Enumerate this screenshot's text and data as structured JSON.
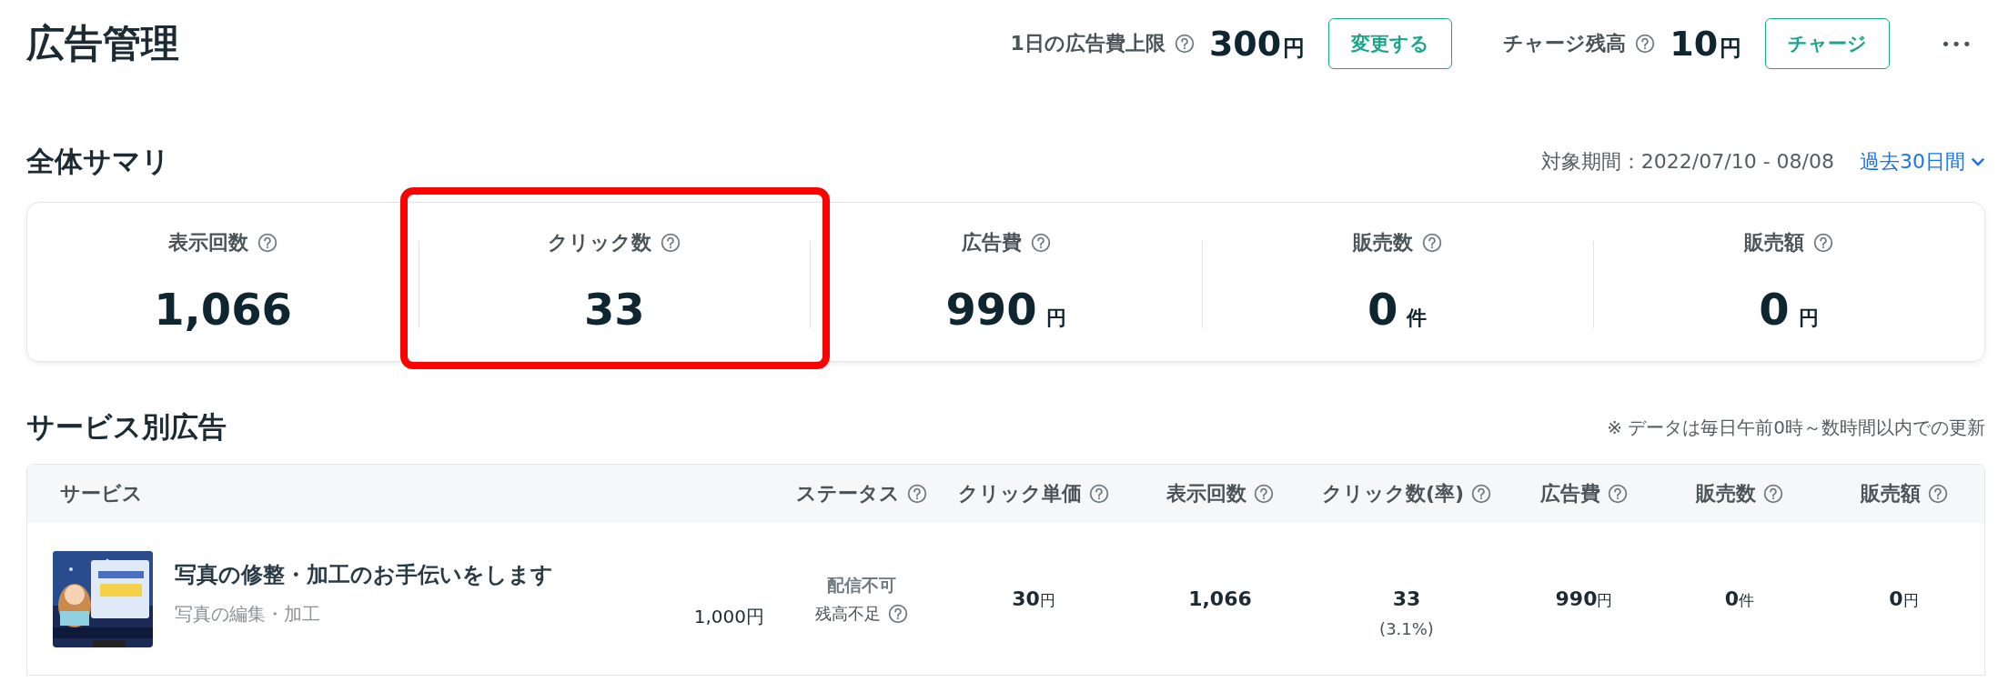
{
  "page_title": "広告管理",
  "header": {
    "daily_limit": {
      "label": "1日の広告費上限",
      "value": "300",
      "unit": "円",
      "button": "変更する"
    },
    "balance": {
      "label": "チャージ残高",
      "value": "10",
      "unit": "円",
      "button": "チャージ"
    },
    "more": "•••"
  },
  "summary": {
    "title": "全体サマリ",
    "period": "対象期間：2022/07/10 - 08/08",
    "range": "過去30日間",
    "metrics": [
      {
        "label": "表示回数",
        "value": "1,066",
        "highlighted": false
      },
      {
        "label": "クリック数",
        "value": "33",
        "highlighted": true
      },
      {
        "label": "広告費",
        "value": "990",
        "unit": "円",
        "highlighted": false
      },
      {
        "label": "販売数",
        "value": "0",
        "unit": "件",
        "highlighted": false
      },
      {
        "label": "販売額",
        "value": "0",
        "unit": "円",
        "highlighted": false
      }
    ]
  },
  "services": {
    "title": "サービス別広告",
    "note": "※ データは毎日午前0時～数時間以内での更新",
    "columns": [
      {
        "label": "サービス",
        "help": false
      },
      {
        "label": "ステータス",
        "help": true
      },
      {
        "label": "クリック単価",
        "help": true
      },
      {
        "label": "表示回数",
        "help": true
      },
      {
        "label": "クリック数(率)",
        "help": true
      },
      {
        "label": "広告費",
        "help": true
      },
      {
        "label": "販売数",
        "help": true
      },
      {
        "label": "販売額",
        "help": true
      }
    ],
    "rows": [
      {
        "name": "写真の修整・加工のお手伝いをします",
        "category": "写真の編集・加工",
        "price": "1,000円",
        "status": "配信不可",
        "status_reason": "残高不足",
        "unit_price": {
          "value": "30",
          "unit": "円"
        },
        "impressions": {
          "value": "1,066"
        },
        "clicks": {
          "value": "33",
          "rate": "(3.1%)"
        },
        "cost": {
          "value": "990",
          "unit": "円"
        },
        "sales": {
          "value": "0",
          "unit": "件"
        },
        "revenue": {
          "value": "0",
          "unit": "円"
        }
      }
    ]
  }
}
